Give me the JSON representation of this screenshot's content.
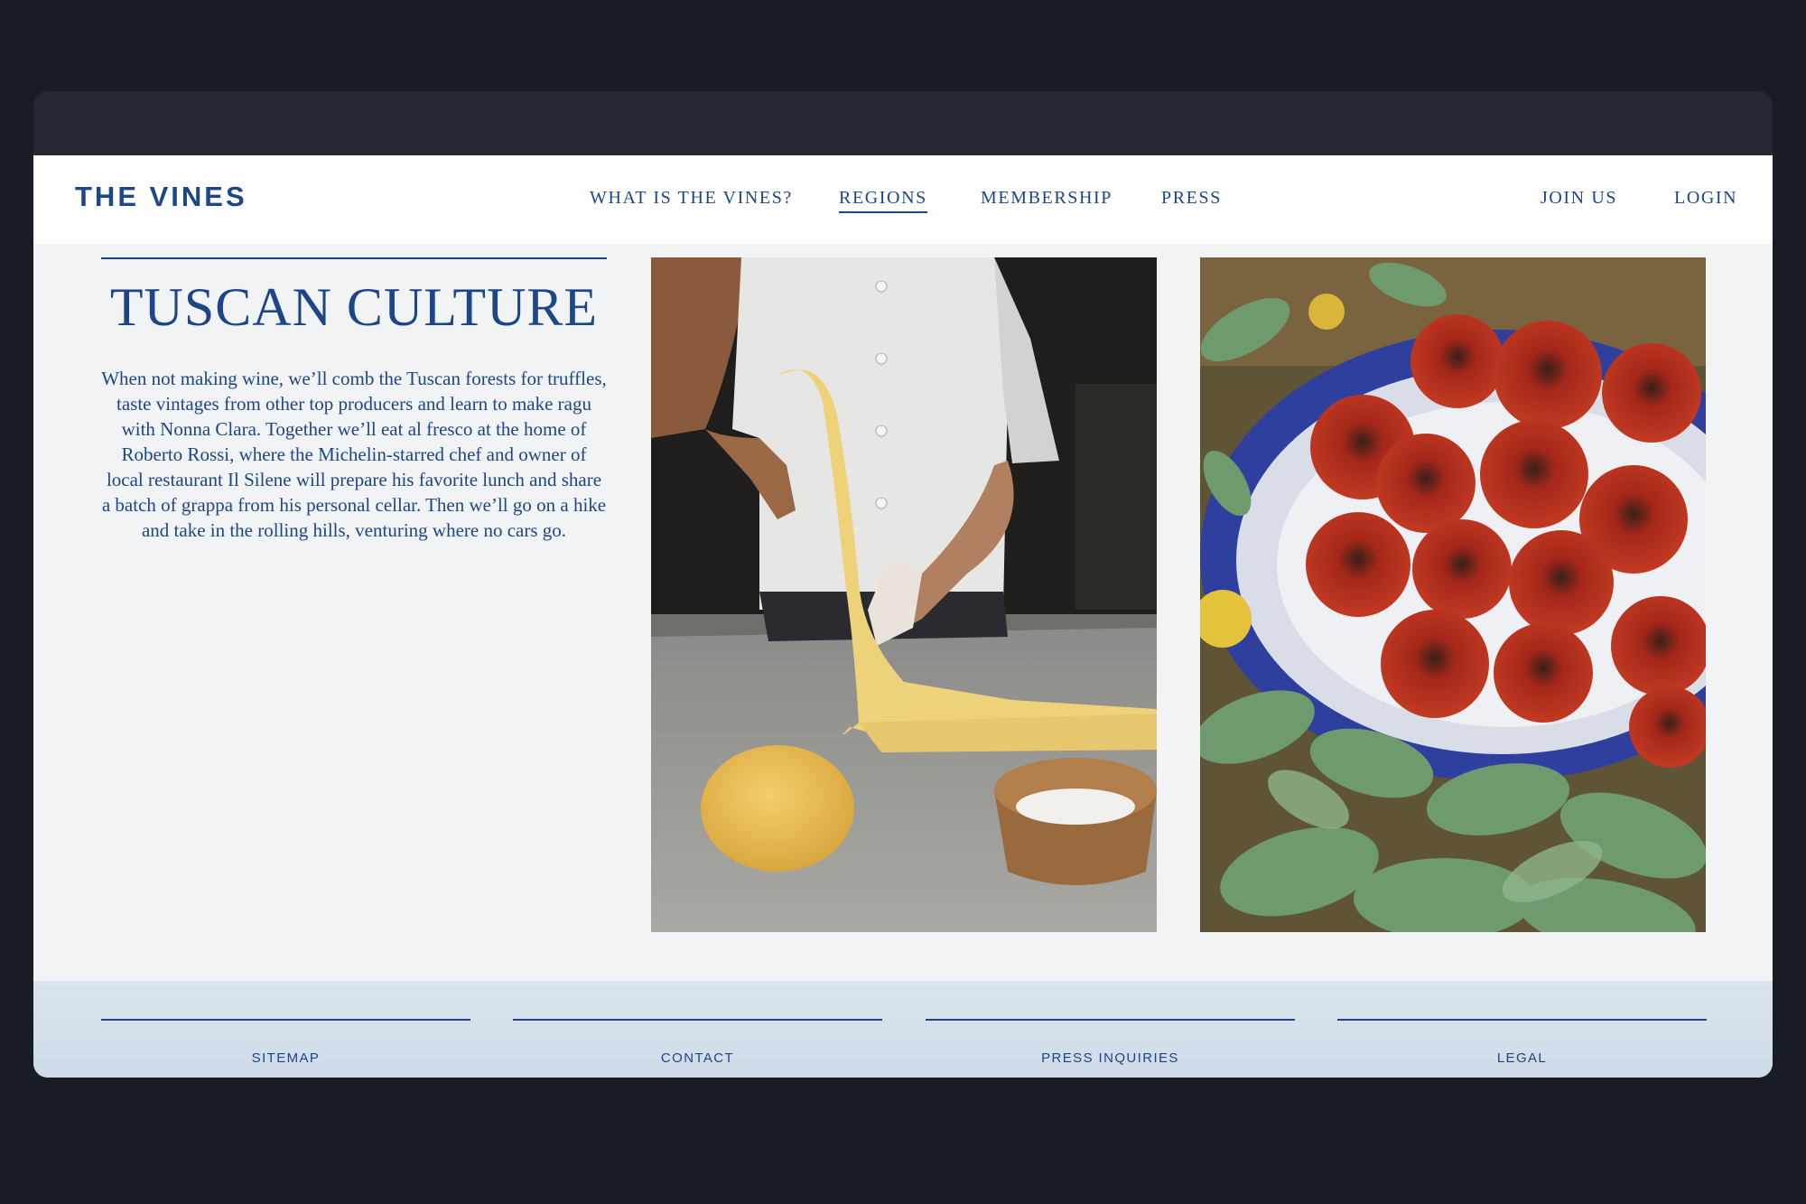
{
  "header": {
    "logo": "THE VINES",
    "nav": [
      {
        "label": "WHAT IS THE VINES?",
        "active": false
      },
      {
        "label": "REGIONS",
        "active": true
      },
      {
        "label": "MEMBERSHIP",
        "active": false
      },
      {
        "label": "PRESS",
        "active": false
      }
    ],
    "join_label": "JOIN US",
    "login_label": "LOGIN"
  },
  "section": {
    "title": "TUSCAN CULTURE",
    "body": "When not making wine, we’ll comb the Tuscan forests for truffles, taste vintages from other top producers and learn to make ragu with Nonna Clara. Together we’ll eat al fresco at the home of  Roberto Rossi, where the Michelin-starred chef and owner of  local restaurant Il Silene will prepare his favorite lunch and share a batch of  grappa from his personal cellar. Then we’ll go on a hike and take in the rolling hills, venturing where no cars go."
  },
  "footer": {
    "links": [
      "SITEMAP",
      "CONTACT",
      "PRESS INQUIRIES",
      "LEGAL"
    ]
  },
  "colors": {
    "brand_blue": "#1c4688",
    "page_bg": "#f2f3f5",
    "footer_bg": "#d9e4ee",
    "outer_bg": "#181c24"
  }
}
